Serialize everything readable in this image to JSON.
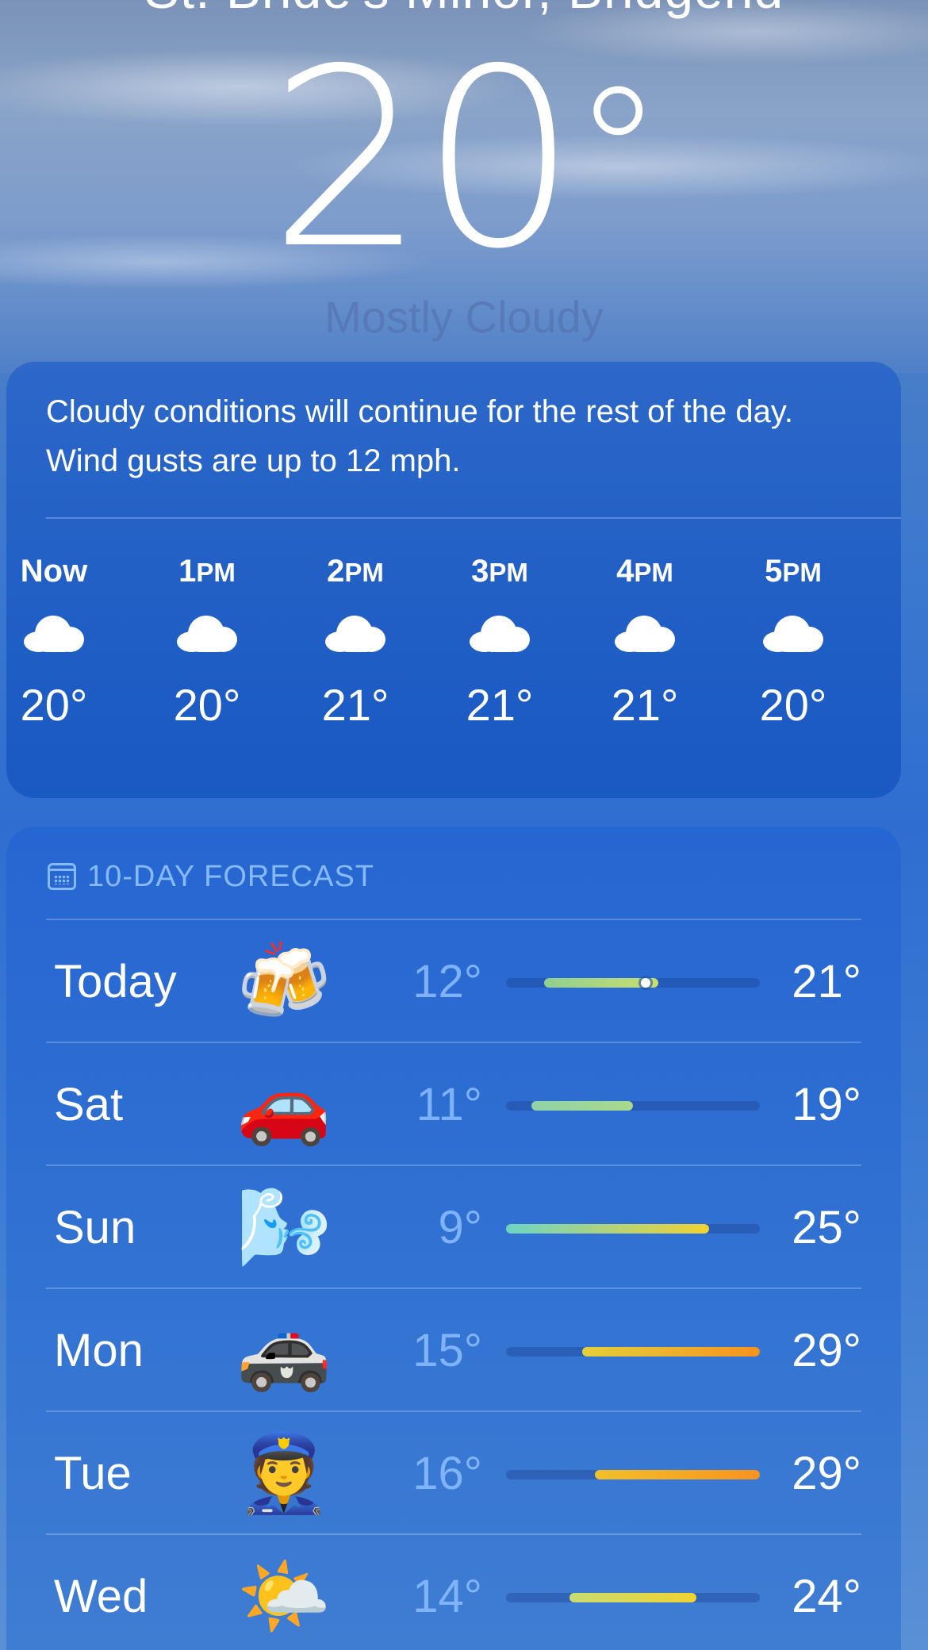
{
  "location": "St. Bride's Minor, Bridgend",
  "current": {
    "temp": "20",
    "degree_symbol": "°",
    "condition": "Mostly Cloudy"
  },
  "hourly": {
    "summary": "Cloudy conditions will continue for the rest of the day. Wind gusts are up to 12 mph.",
    "items": [
      {
        "time": "Now",
        "ampm": "",
        "icon": "cloud-icon",
        "temp": "20°"
      },
      {
        "time": "1",
        "ampm": "PM",
        "icon": "cloud-icon",
        "temp": "20°"
      },
      {
        "time": "2",
        "ampm": "PM",
        "icon": "cloud-icon",
        "temp": "21°"
      },
      {
        "time": "3",
        "ampm": "PM",
        "icon": "cloud-icon",
        "temp": "21°"
      },
      {
        "time": "4",
        "ampm": "PM",
        "icon": "cloud-icon",
        "temp": "21°"
      },
      {
        "time": "5",
        "ampm": "PM",
        "icon": "cloud-icon",
        "temp": "20°"
      }
    ]
  },
  "forecast": {
    "header": "10-DAY FORECAST",
    "header_icon": "calendar-icon",
    "range_min": 9,
    "range_max": 29,
    "days": [
      {
        "day": "Today",
        "emoji": "🍻",
        "icon": "beer-mugs-icon",
        "low": "12°",
        "high": "21°",
        "low_val": 12,
        "high_val": 21,
        "now_val": 20,
        "colors": [
          "#8fcf90",
          "#c9de6e"
        ]
      },
      {
        "day": "Sat",
        "emoji": "🚗",
        "icon": "car-icon",
        "low": "11°",
        "high": "19°",
        "low_val": 11,
        "high_val": 19,
        "colors": [
          "#8fd3a8",
          "#a9d98c"
        ]
      },
      {
        "day": "Sun",
        "emoji": "🌬️",
        "icon": "wind-face-icon",
        "low": "9°",
        "high": "25°",
        "low_val": 9,
        "high_val": 25,
        "colors": [
          "#6dd4c4",
          "#f2d232"
        ]
      },
      {
        "day": "Mon",
        "emoji": "🚓",
        "icon": "police-car-icon",
        "low": "15°",
        "high": "29°",
        "low_val": 15,
        "high_val": 29,
        "colors": [
          "#e4d03a",
          "#f7931e"
        ]
      },
      {
        "day": "Tue",
        "emoji": "👮",
        "icon": "police-officer-icon",
        "low": "16°",
        "high": "29°",
        "low_val": 16,
        "high_val": 29,
        "colors": [
          "#f2c02a",
          "#f7931e"
        ]
      },
      {
        "day": "Wed",
        "emoji": "🌤️",
        "icon": "sun-behind-cloud-icon",
        "low": "14°",
        "high": "24°",
        "low_val": 14,
        "high_val": 24,
        "colors": [
          "#c9dd70",
          "#f2d232"
        ]
      }
    ]
  }
}
